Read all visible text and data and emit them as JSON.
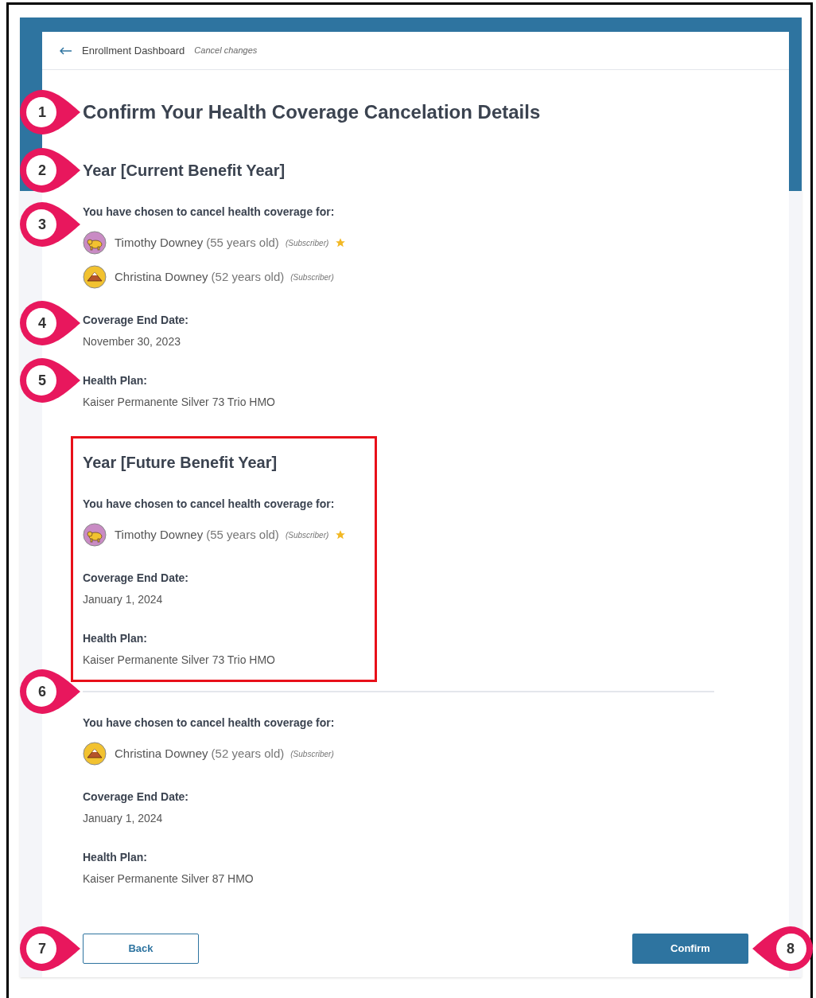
{
  "header": {
    "back_link": "Enrollment Dashboard",
    "cancel_link": "Cancel changes"
  },
  "title": {
    "text": "Confirm Your Health Coverage Cancelation Details",
    "callout": "1"
  },
  "sections": [
    {
      "heading": "Year [Current Benefit Year]",
      "heading_callout": "2",
      "highlighted": false,
      "divider_before": false,
      "members_label": "You have chosen to cancel health coverage for:",
      "members_callout": "3",
      "members": [
        {
          "name": "Timothy Downey",
          "age": "(55 years old)",
          "role": "(Subscriber)",
          "primary": true,
          "kind": "bear",
          "color": "#c98bc4"
        },
        {
          "name": "Christina Downey",
          "age": "(52 years old)",
          "role": "(Subscriber)",
          "primary": false,
          "kind": "mountain",
          "color": "#f2c230"
        }
      ],
      "end_date_label": "Coverage End Date:",
      "end_date": "November 30, 2023",
      "end_date_callout": "4",
      "plan_label": "Health Plan:",
      "plan": "Kaiser Permanente Silver 73 Trio HMO",
      "plan_callout": "5"
    },
    {
      "heading": "Year [Future Benefit Year]",
      "highlighted": true,
      "divider_before": false,
      "members_label": "You have chosen to cancel health coverage for:",
      "members": [
        {
          "name": "Timothy Downey",
          "age": "(55 years old)",
          "role": "(Subscriber)",
          "primary": true,
          "kind": "bear",
          "color": "#c98bc4"
        }
      ],
      "end_date_label": "Coverage End Date:",
      "end_date": "January 1, 2024",
      "plan_label": "Health Plan:",
      "plan": "Kaiser Permanente Silver 73 Trio HMO"
    },
    {
      "highlighted": false,
      "divider_before": true,
      "divider_callout": "6",
      "members_label": "You have chosen to cancel health coverage for:",
      "members": [
        {
          "name": "Christina Downey",
          "age": "(52 years old)",
          "role": "(Subscriber)",
          "primary": false,
          "kind": "mountain",
          "color": "#f2c230"
        }
      ],
      "end_date_label": "Coverage End Date:",
      "end_date": "January 1, 2024",
      "plan_label": "Health Plan:",
      "plan": "Kaiser Permanente Silver 87 HMO"
    }
  ],
  "buttons": [
    {
      "label": "Back",
      "kind": "secondary",
      "callout": "7"
    },
    {
      "label": "Confirm",
      "kind": "primary",
      "callout": "8"
    }
  ]
}
